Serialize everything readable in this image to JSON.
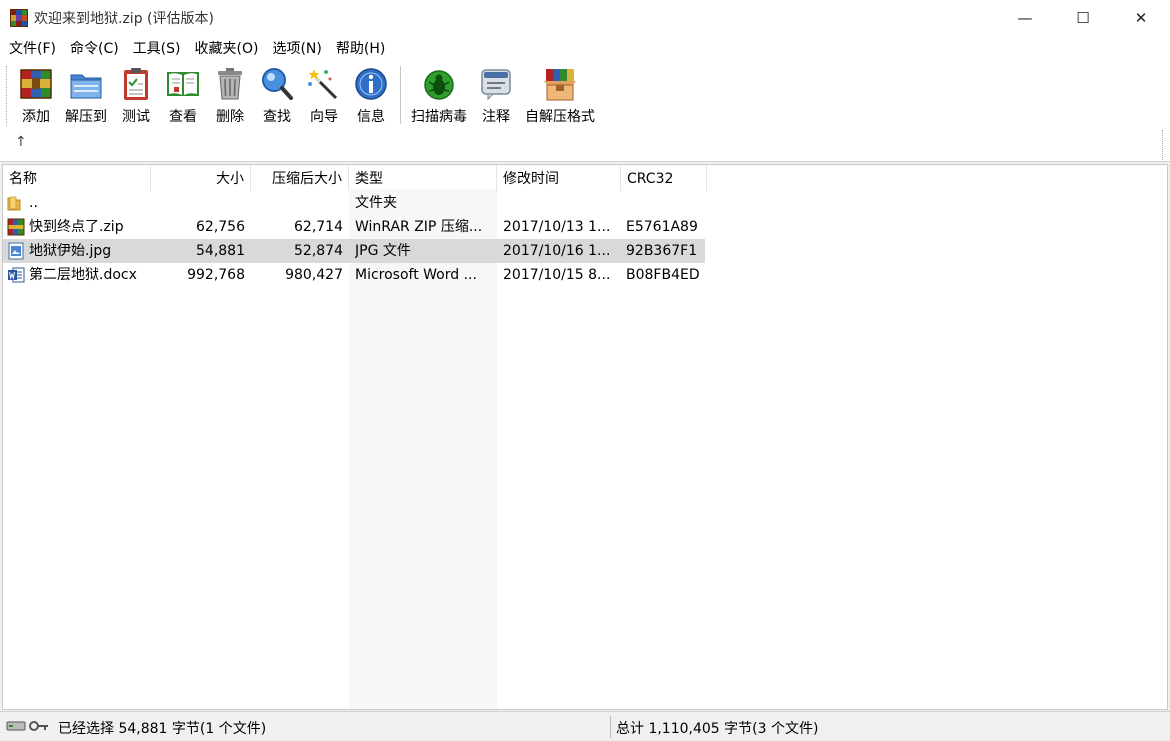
{
  "window": {
    "title": "欢迎来到地狱.zip (评估版本)",
    "minimize": "—",
    "maximize": "☐",
    "close": "✕"
  },
  "menu": [
    "文件(F)",
    "命令(C)",
    "工具(S)",
    "收藏夹(O)",
    "选项(N)",
    "帮助(H)"
  ],
  "toolbar": {
    "add": "添加",
    "extract": "解压到",
    "test": "测试",
    "view": "查看",
    "delete": "删除",
    "find": "查找",
    "wizard": "向导",
    "info": "信息",
    "virus": "扫描病毒",
    "comment": "注释",
    "sfx": "自解压格式"
  },
  "address": {
    "up": "↑"
  },
  "columns": {
    "name": "名称",
    "size": "大小",
    "packed": "压缩后大小",
    "type": "类型",
    "modified": "修改时间",
    "crc": "CRC32",
    "sort_indicator": "^"
  },
  "rows": [
    {
      "name": "..",
      "size": "",
      "packed": "",
      "type": "文件夹",
      "modified": "",
      "crc": "",
      "icon": "folder-icon"
    },
    {
      "name": "快到终点了.zip",
      "size": "62,756",
      "packed": "62,714",
      "type": "WinRAR ZIP 压缩...",
      "modified": "2017/10/13 1...",
      "crc": "E5761A89",
      "icon": "winrar-archive-icon"
    },
    {
      "name": "地狱伊始.jpg",
      "size": "54,881",
      "packed": "52,874",
      "type": "JPG 文件",
      "modified": "2017/10/16 1...",
      "crc": "92B367F1",
      "icon": "image-file-icon"
    },
    {
      "name": "第二层地狱.docx",
      "size": "992,768",
      "packed": "980,427",
      "type": "Microsoft Word ...",
      "modified": "2017/10/15 8...",
      "crc": "B08FB4ED",
      "icon": "word-document-icon"
    }
  ],
  "status": {
    "selected": "已经选择 54,881 字节(1 个文件)",
    "total": "总计 1,110,405 字节(3 个文件)"
  },
  "colors": {
    "selection": "#d9d9d9",
    "type_column_bg": "#f7f7f7"
  }
}
